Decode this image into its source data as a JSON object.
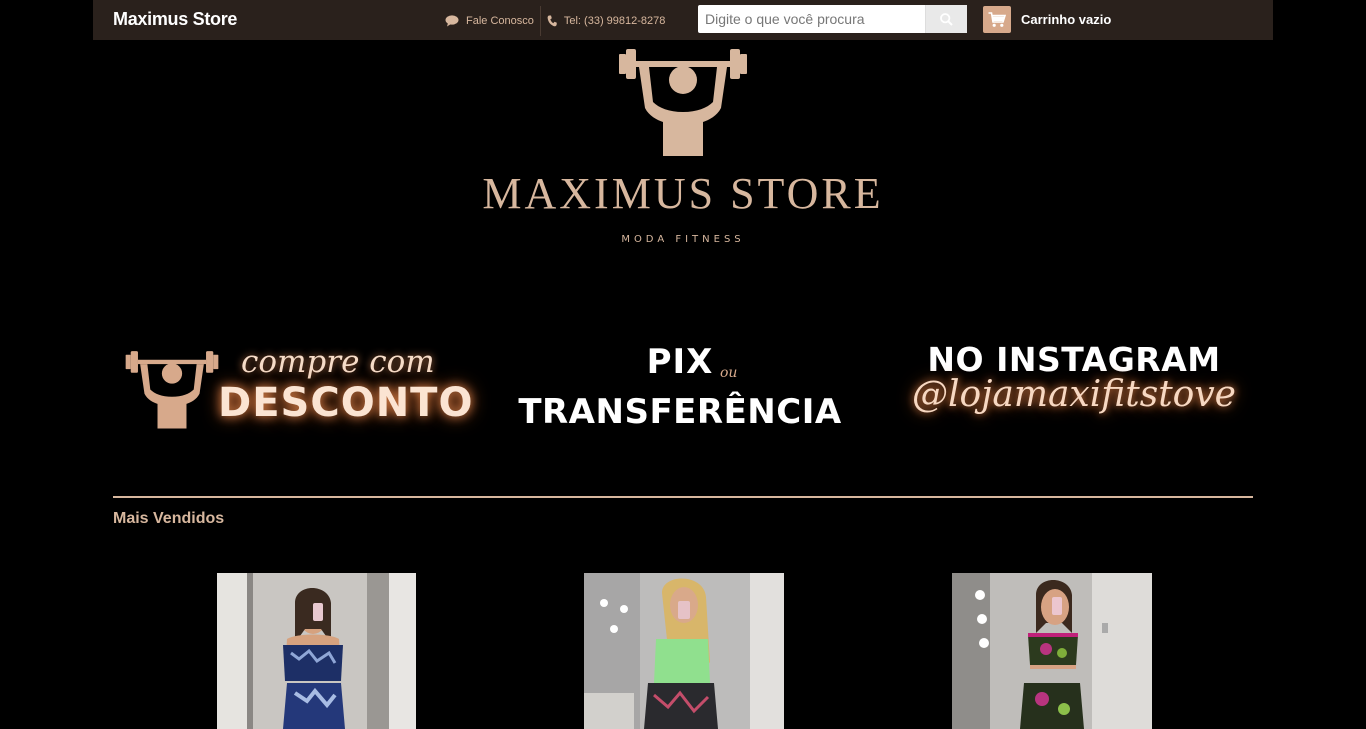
{
  "header": {
    "brand": "Maximus Store",
    "contact_label": "Fale Conosco",
    "phone_label": "Tel: (33) 99812-8278",
    "search_placeholder": "Digite o que você procura",
    "cart_label": "Carrinho vazio"
  },
  "logo": {
    "name": "MAXIMUS STORE",
    "tagline": "MODA FITNESS"
  },
  "banners": [
    {
      "line1": "compre com",
      "line2": "DESCONTO"
    },
    {
      "line1": "PIX",
      "connector": "ou",
      "line2": "TRANSFERÊNCIA"
    },
    {
      "line1": "NO INSTAGRAM",
      "line2": "@lojamaxifitstove"
    }
  ],
  "section": {
    "title": "Mais Vendidos"
  },
  "colors": {
    "accent": "#d7b79e",
    "topbar": "#2a211c",
    "background": "#000000",
    "cart_icon_bg": "#d7a98b"
  },
  "icons": {
    "contact": "chat-bubble-icon",
    "phone": "phone-icon",
    "search": "search-icon",
    "cart": "shopping-cart-icon"
  }
}
